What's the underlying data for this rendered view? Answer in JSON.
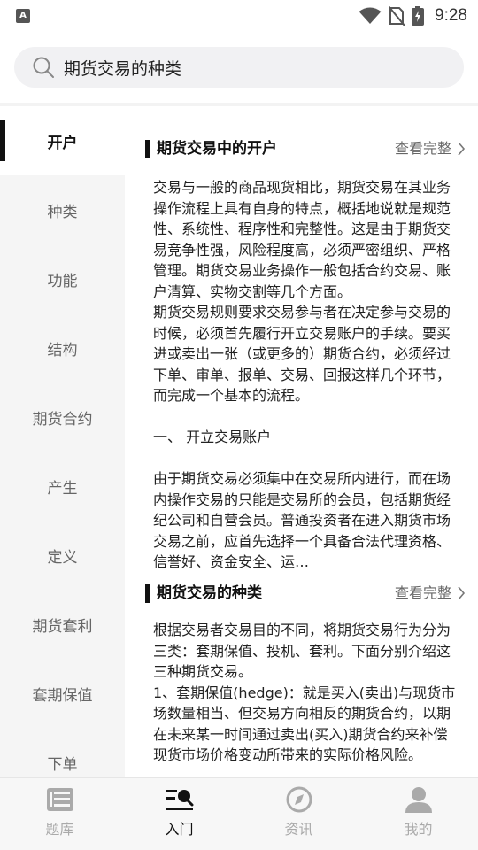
{
  "status_bar": {
    "app_badge": "A",
    "time": "9:28"
  },
  "search": {
    "query": "期货交易的种类"
  },
  "sidebar": {
    "items": [
      {
        "label": "开户",
        "active": true
      },
      {
        "label": "种类"
      },
      {
        "label": "功能"
      },
      {
        "label": "结构"
      },
      {
        "label": "期货合约"
      },
      {
        "label": "产生"
      },
      {
        "label": "定义"
      },
      {
        "label": "期货套利"
      },
      {
        "label": "套期保值"
      },
      {
        "label": "下单"
      }
    ]
  },
  "cards": [
    {
      "title": "期货交易中的开户",
      "more": "查看完整",
      "paragraphs": [
        "交易与一般的商品现货相比，期货交易在其业务操作流程上具有自身的特点，概括地说就是规范性、系统性、程序性和完整性。这是由于期货交易竞争性强，风险程度高，必须严密组织、严格管理。期货交易业务操作一般包括合约交易、账户清算、实物交割等几个方面。",
        "期货交易规则要求交易参与者在决定参与交易的时候，必须首先履行开立交易账户的手续。要买进或卖出一张（或更多的）期货合约，必须经过下单、审单、报单、交易、回报这样几个环节，而完成一个基本的流程。",
        "",
        "一、 开立交易账户",
        "",
        "由于期货交易必须集中在交易所内进行，而在场内操作交易的只能是交易所的会员，包括期货经纪公司和自营会员。普通投资者在进入期货市场交易之前，应首先选择一个具备合法代理资格、信誉好、资金安全、运…"
      ]
    },
    {
      "title": "期货交易的种类",
      "more": "查看完整",
      "paragraphs": [
        "根据交易者交易目的不同，将期货交易行为分为三类：套期保值、投机、套利。下面分别介绍这三种期货交易。",
        "1、套期保值(hedge)：就是买入(卖出)与现货市场数量相当、但交易方向相反的期货合约，以期在未来某一时间通过卖出(买入)期货合约来补偿现货市场价格变动所带来的实际价格风险。"
      ]
    }
  ],
  "bottom_nav": {
    "items": [
      {
        "label": "题库",
        "icon": "book-list-icon"
      },
      {
        "label": "入门",
        "icon": "learn-search-icon",
        "active": true
      },
      {
        "label": "资讯",
        "icon": "compass-icon"
      },
      {
        "label": "我的",
        "icon": "person-icon"
      }
    ]
  },
  "colors": {
    "accent": "#111111",
    "inactive": "#aaaaaa",
    "sidebar_bg": "#f5f5f5"
  }
}
